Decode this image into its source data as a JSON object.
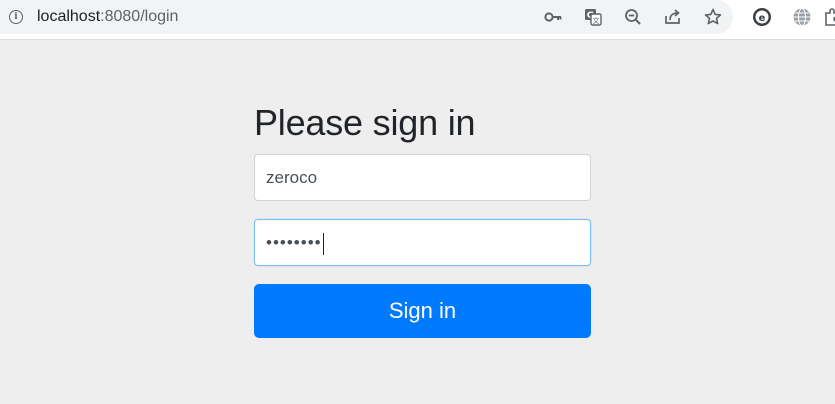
{
  "browser": {
    "url_host": "localhost",
    "url_rest": ":8080/login",
    "icons": [
      "key-icon",
      "translate-icon",
      "zoom-out-icon",
      "share-icon",
      "bookmark-star-icon"
    ],
    "extensions": [
      "extension-e-icon",
      "globe-icon",
      "puzzle-icon"
    ]
  },
  "login": {
    "title": "Please sign in",
    "username_value": "zeroco",
    "password_mask": "••••••••",
    "submit_label": "Sign in"
  },
  "colors": {
    "page_bg": "#eeeeee",
    "primary": "#007bff",
    "focus_border": "#80bdff"
  }
}
